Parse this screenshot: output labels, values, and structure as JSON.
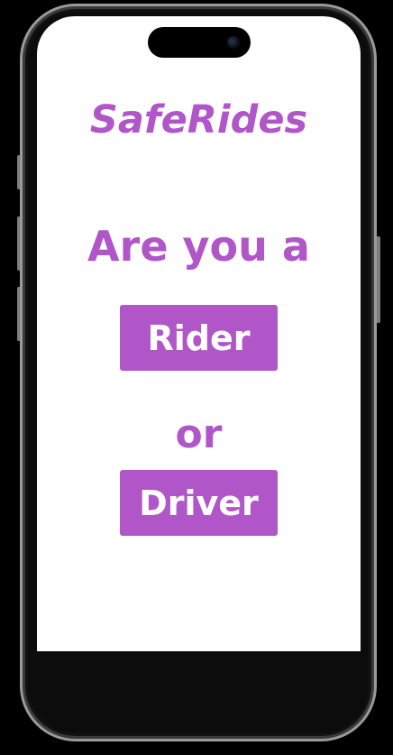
{
  "app": {
    "title": "SafeRides"
  },
  "main": {
    "question": "Are you a",
    "rider_label": "Rider",
    "separator": "or",
    "driver_label": "Driver"
  },
  "colors": {
    "accent": "#b056c9",
    "background": "#ffffff",
    "button_text": "#ffffff"
  }
}
